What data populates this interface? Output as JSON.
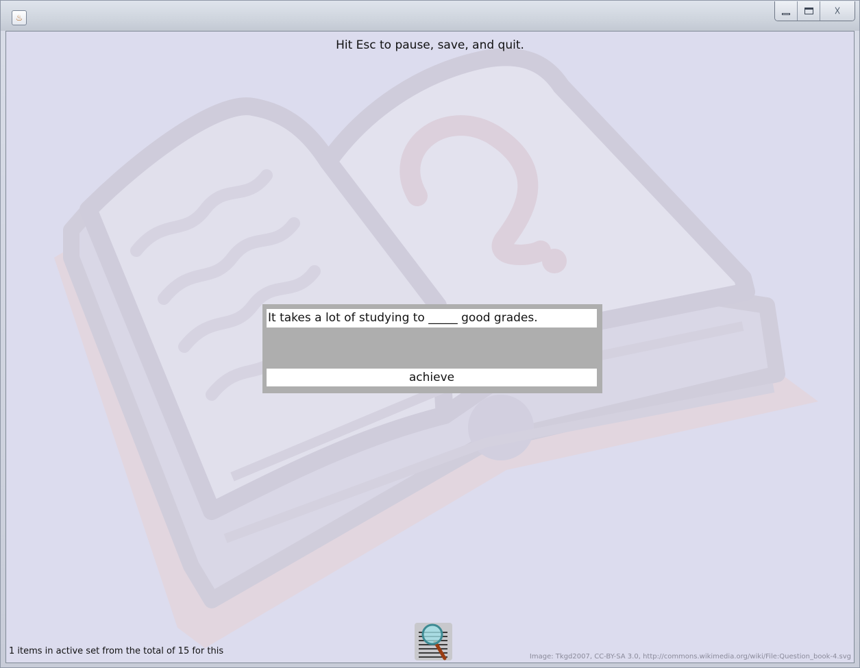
{
  "window": {
    "app_icon": "java-icon",
    "controls": [
      "minimize-icon",
      "maximize-icon",
      "close-icon"
    ],
    "close_glyph": "☓"
  },
  "hint": "Hit Esc to pause, save, and quit.",
  "quiz": {
    "question": "It takes a lot of studying to _____ good grades.",
    "answer": "achieve"
  },
  "status": "1 items in active set from the total of 15 for this",
  "credit": "Image: Tkgd2007, CC-BY-SA 3.0, http://commons.wikimedia.org/wiki/File:Question_book-4.svg",
  "search_icon": "magnifier-document-icon",
  "colors": {
    "background": "#dcdcee",
    "card": "#aeaeae",
    "book_outline": "#d2cfdc",
    "book_shadow": "#e6d2d6"
  }
}
